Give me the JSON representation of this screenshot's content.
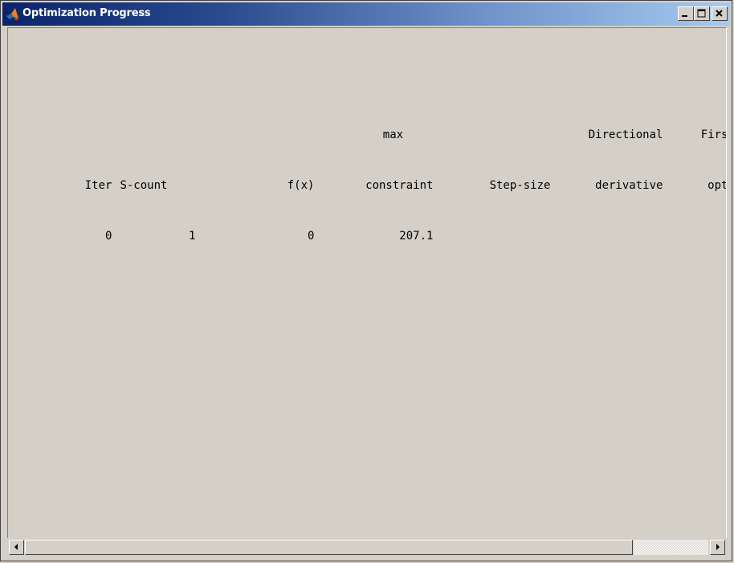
{
  "window": {
    "title": "Optimization Progress",
    "controls": [
      "minimize-icon",
      "maximize-icon",
      "close-icon"
    ]
  },
  "colors": {
    "titlebar_start": "#0a246a",
    "titlebar_end": "#a6caf0",
    "background": "#d4d0c8",
    "text": "#000000"
  },
  "table": {
    "header_row1": [
      "",
      "",
      "",
      "max",
      "",
      "Directional",
      "First-order"
    ],
    "header_row2": [
      "Iter",
      "S-count",
      "f(x)",
      "constraint",
      "Step-size",
      "derivative",
      "optimality"
    ],
    "rows": [
      [
        "0",
        "1",
        "0",
        "207.1",
        "",
        "",
        ""
      ]
    ]
  }
}
